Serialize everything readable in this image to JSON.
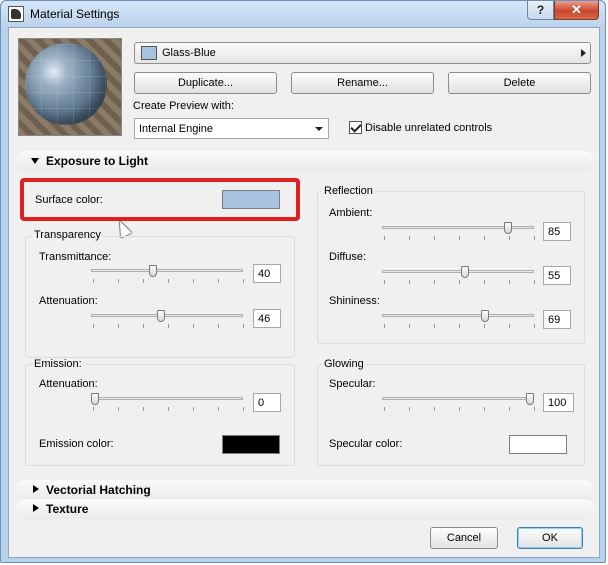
{
  "window": {
    "title": "Material Settings",
    "help_glyph": "?",
    "close_glyph": "✕"
  },
  "material": {
    "name": "Glass-Blue",
    "swatch_color": "#a9c2e0"
  },
  "actions": {
    "duplicate": "Duplicate...",
    "rename": "Rename...",
    "delete": "Delete"
  },
  "preview": {
    "label": "Create Preview with:",
    "engine": "Internal Engine"
  },
  "disable_unrelated": {
    "label": "Disable unrelated controls",
    "checked": true
  },
  "exposure": {
    "header": "Exposure to Light",
    "surface_color_label": "Surface color:",
    "surface_color": "#a9c2e0",
    "transparency": {
      "title": "Transparency",
      "transmittance_label": "Transmittance:",
      "transmittance": "40",
      "transmittance_fraction": 0.4,
      "attenuation_label": "Attenuation:",
      "attenuation": "46",
      "attenuation_fraction": 0.46
    },
    "reflection": {
      "title": "Reflection",
      "ambient_label": "Ambient:",
      "ambient": "85",
      "ambient_fraction": 0.85,
      "diffuse_label": "Diffuse:",
      "diffuse": "55",
      "diffuse_fraction": 0.55,
      "shininess_label": "Shininess:",
      "shininess": "69",
      "shininess_fraction": 0.69
    },
    "emission": {
      "title": "Emission:",
      "attenuation_label": "Attenuation:",
      "attenuation": "0",
      "attenuation_fraction": 0.0,
      "color_label": "Emission color:",
      "color": "#000000"
    },
    "glowing": {
      "title": "Glowing",
      "specular_label": "Specular:",
      "specular": "100",
      "specular_fraction": 1.0,
      "color_label": "Specular color:",
      "color": "#ffffff"
    }
  },
  "sections": {
    "vectorial": "Vectorial Hatching",
    "texture": "Texture"
  },
  "footer": {
    "cancel": "Cancel",
    "ok": "OK"
  },
  "colors": {
    "highlight": "#e02020"
  }
}
